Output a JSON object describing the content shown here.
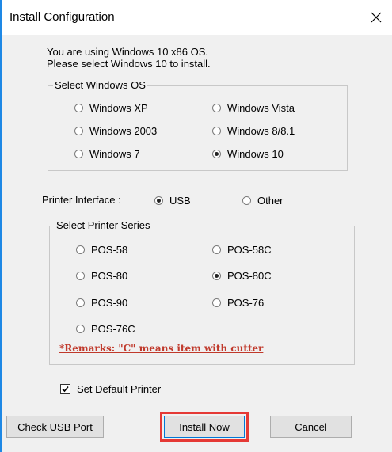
{
  "window": {
    "title": "Install Configuration",
    "close_glyph": "✕"
  },
  "info": {
    "line1": "You are using Windows 10 x86 OS.",
    "line2": "Please select Windows 10 to install."
  },
  "os_group": {
    "label": "Select Windows OS",
    "options": [
      {
        "label": "Windows XP",
        "selected": false
      },
      {
        "label": "Windows Vista",
        "selected": false
      },
      {
        "label": "Windows 2003",
        "selected": false
      },
      {
        "label": "Windows 8/8.1",
        "selected": false
      },
      {
        "label": "Windows 7",
        "selected": false
      },
      {
        "label": "Windows 10",
        "selected": true
      }
    ]
  },
  "interface": {
    "label": "Printer Interface :",
    "options": [
      {
        "label": "USB",
        "selected": true
      },
      {
        "label": "Other",
        "selected": false
      }
    ]
  },
  "printer_group": {
    "label": "Select Printer Series",
    "options": [
      {
        "label": "POS-58",
        "selected": false
      },
      {
        "label": "POS-58C",
        "selected": false
      },
      {
        "label": "POS-80",
        "selected": false
      },
      {
        "label": "POS-80C",
        "selected": true
      },
      {
        "label": "POS-90",
        "selected": false
      },
      {
        "label": "POS-76",
        "selected": false
      },
      {
        "label": "POS-76C",
        "selected": false
      }
    ],
    "remarks": "*Remarks: \"C\" means item with cutter"
  },
  "default_printer": {
    "label": "Set Default Printer",
    "checked": true
  },
  "buttons": {
    "check_usb": "Check USB Port",
    "install": "Install Now",
    "cancel": "Cancel"
  },
  "colors": {
    "window_border": "#1e88e5",
    "remarks": "#c0392b",
    "highlight": "#e53935"
  }
}
